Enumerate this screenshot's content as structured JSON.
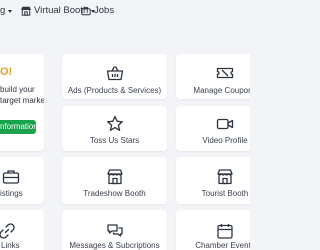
{
  "nav": {
    "item1_label": "g",
    "virtual_booth_label": "Virtual Booth",
    "jobs_label": "Jobs"
  },
  "promo": {
    "title": "O!",
    "line1": "build your",
    "line2": "target market.",
    "button_label": "nformation"
  },
  "tiles": {
    "ads": "Ads (Products & Services)",
    "manage_coupons": "Manage Coupons",
    "toss_us_stars": "Toss Us Stars",
    "video_profile": "Video Profile",
    "listings": "istings",
    "tradeshow_booth": "Tradeshow Booth",
    "tourist_booth": "Tourist Booth",
    "links": "Links",
    "messages": "Messages & Subcriptions",
    "chamber_events": "Chamber Events"
  },
  "colors": {
    "accent": "#2f6fc0",
    "promo_title": "#e6a521",
    "button": "#16a34a"
  }
}
